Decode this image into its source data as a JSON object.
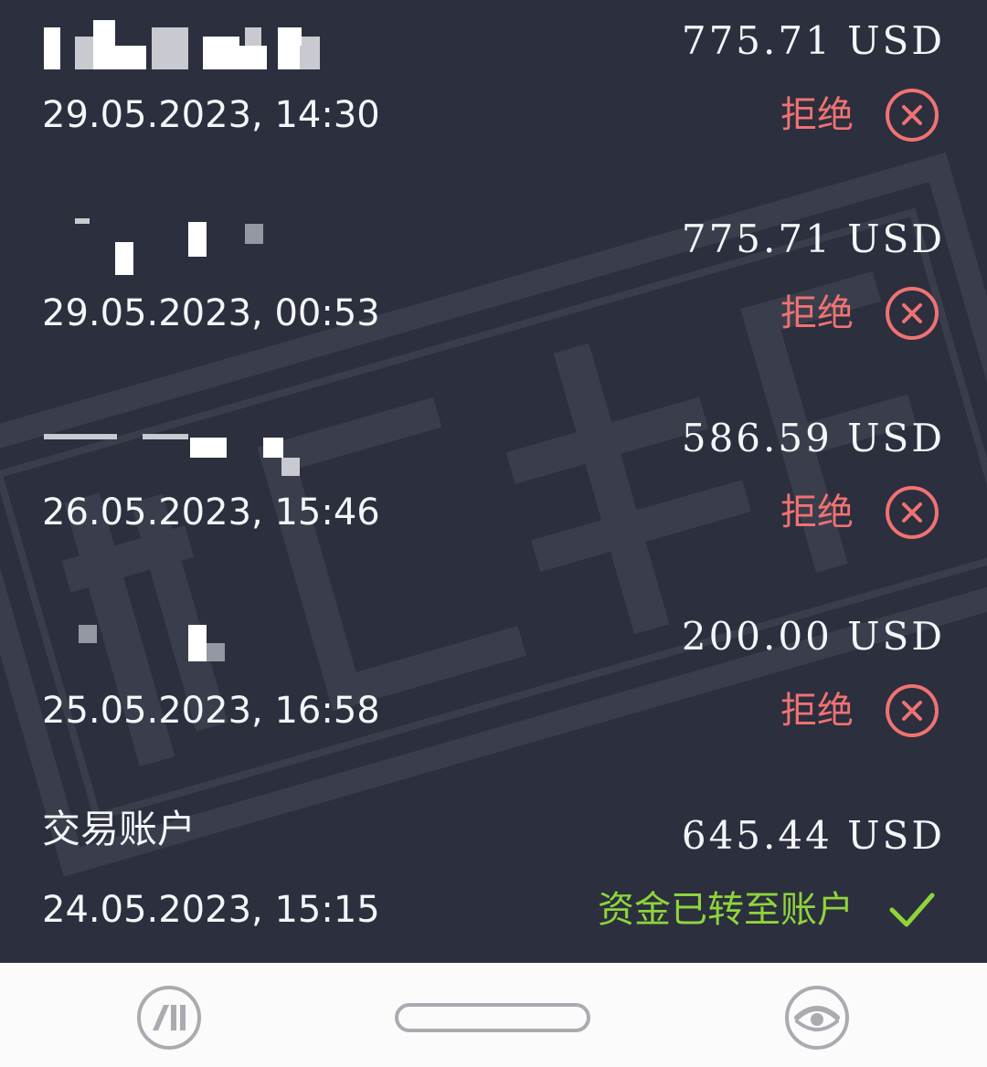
{
  "colors": {
    "background": "#2b2f3e",
    "text": "#f4f5f7",
    "rejected": "#f07272",
    "success": "#8fd43a",
    "navbar": "#fbfbfb"
  },
  "transactions": [
    {
      "name": "",
      "amount": "775.71 USD",
      "date": "29.05.2023, 14:30",
      "status": "拒绝",
      "status_type": "rejected",
      "status_icon": "circle-x-icon"
    },
    {
      "name": "",
      "amount": "775.71 USD",
      "date": "29.05.2023, 00:53",
      "status": "拒绝",
      "status_type": "rejected",
      "status_icon": "circle-x-icon"
    },
    {
      "name": "",
      "amount": "586.59 USD",
      "date": "26.05.2023, 15:46",
      "status": "拒绝",
      "status_type": "rejected",
      "status_icon": "circle-x-icon"
    },
    {
      "name": "",
      "amount": "200.00 USD",
      "date": "25.05.2023, 16:58",
      "status": "拒绝",
      "status_type": "rejected",
      "status_icon": "circle-x-icon"
    },
    {
      "name": "交易账户",
      "amount": "645.44 USD",
      "date": "24.05.2023, 15:15",
      "status": "资金已转至账户",
      "status_type": "success",
      "status_icon": "checkmark-icon"
    }
  ],
  "navbar": {
    "left_icon": "app-logo-icon",
    "center_icon": "home-pill-icon",
    "right_icon": "eye-logo-icon"
  }
}
